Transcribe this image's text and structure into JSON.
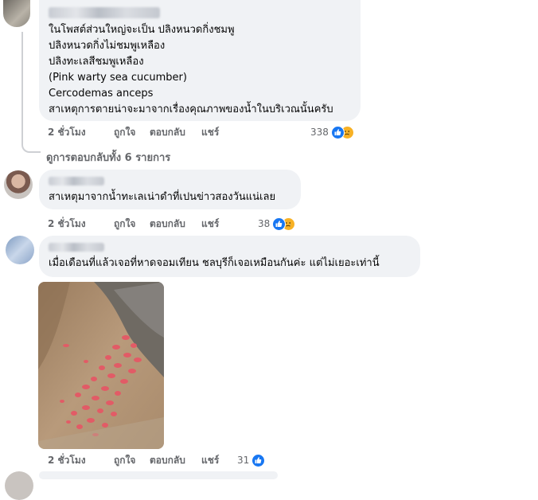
{
  "comments": [
    {
      "lines": [
        "ในโพสต์ส่วนใหญ่จะเป็น ปลิงหนวดกิ่งชมพู",
        "ปลิงหนวดกิ่งไม่ชมพูเหลือง",
        "ปลิงทะเลสีชมพูเหลือง",
        "(Pink warty sea cucumber)",
        "Cercodemas anceps",
        "สาเหตุการตายน่าจะมาจากเรื่องคุณภาพของน้ำในบริเวณนั้นครับ"
      ],
      "time": "2 ชั่วโมง",
      "like": "ถูกใจ",
      "reply": "ตอบกลับ",
      "share": "แชร์",
      "reaction_count": "338",
      "reactions": [
        "like-icon",
        "sad-icon"
      ],
      "view_replies": "ดูการตอบกลับทั้ง 6 รายการ"
    },
    {
      "lines": [
        "สาเหตุมาจากน้ำทะเลเน่าดำที่เปนข่าวสองวันแน่เลย"
      ],
      "time": "2 ชั่วโมง",
      "like": "ถูกใจ",
      "reply": "ตอบกลับ",
      "share": "แชร์",
      "reaction_count": "38",
      "reactions": [
        "like-icon",
        "sad-icon"
      ]
    },
    {
      "lines": [
        "เมื่อเดือนที่แล้วเจอที่หาดจอมเทียน ชลบุรีก็เจอเหมือนกันค่ะ แต่ไม่เยอะเท่านี้"
      ],
      "time": "2 ชั่วโมง",
      "like": "ถูกใจ",
      "reply": "ตอบกลับ",
      "share": "แชร์",
      "reaction_count": "31",
      "reactions": [
        "like-icon"
      ]
    }
  ],
  "colors": {
    "bubble": "#f0f2f5",
    "meta_text": "#65676b",
    "like_blue": "#1877f2",
    "sad_yellow": "#f7b125"
  }
}
